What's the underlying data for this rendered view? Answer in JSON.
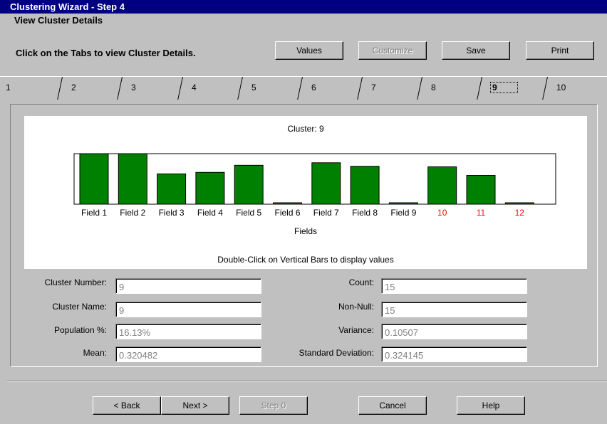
{
  "window": {
    "title": "Clustering Wizard - Step 4",
    "subtitle": "View Cluster Details"
  },
  "instruction": "Click on the Tabs to view Cluster Details.",
  "toolbar": {
    "values_label": "Values",
    "values_u": "V",
    "customize_label": "Customize",
    "save_label": "Save",
    "save_u": "S",
    "print_label": "Print",
    "print_u": "P"
  },
  "tabs": [
    "1",
    "2",
    "3",
    "4",
    "5",
    "6",
    "7",
    "8",
    "9",
    "10"
  ],
  "active_tab": "9",
  "chart_data": {
    "type": "bar",
    "title": "Cluster: 9",
    "xlabel": "Fields",
    "note": "Double-Click on Vertical Bars to display values",
    "categories": [
      "Field 1",
      "Field 2",
      "Field 3",
      "Field 4",
      "Field 5",
      "Field 6",
      "Field 7",
      "Field 8",
      "Field 9",
      "10",
      "11",
      "12"
    ],
    "values": [
      1.0,
      1.0,
      0.6,
      0.63,
      0.77,
      0.0,
      0.82,
      0.75,
      0.0,
      0.74,
      0.57,
      0.0
    ],
    "ylim": [
      0,
      1
    ],
    "bar_color": "#008000",
    "label_colors": [
      "#000000",
      "#000000",
      "#000000",
      "#000000",
      "#000000",
      "#000000",
      "#000000",
      "#000000",
      "#000000",
      "#ff0000",
      "#ff0000",
      "#ff0000"
    ]
  },
  "details": {
    "cluster_number_label": "Cluster Number:",
    "cluster_number": "9",
    "cluster_name_label": "Cluster Name:",
    "cluster_name": "9",
    "population_label": "Population %:",
    "population": "16.13%",
    "mean_label": "Mean:",
    "mean": "0.320482",
    "count_label": "Count:",
    "count": "15",
    "nonnull_label": "Non-Null:",
    "nonnull": "15",
    "variance_label": "Variance:",
    "variance": "0.10507",
    "stddev_label": "Standard Deviation:",
    "stddev": "0.324145"
  },
  "footer": {
    "back_label": "Back",
    "back_prefix": "< ",
    "back_u": "B",
    "next_label": "Next >",
    "next_u": "N",
    "step0_label": "Step 0",
    "cancel_label": "Cancel",
    "cancel_u": "C",
    "help_label": "Help",
    "help_u": "H"
  }
}
